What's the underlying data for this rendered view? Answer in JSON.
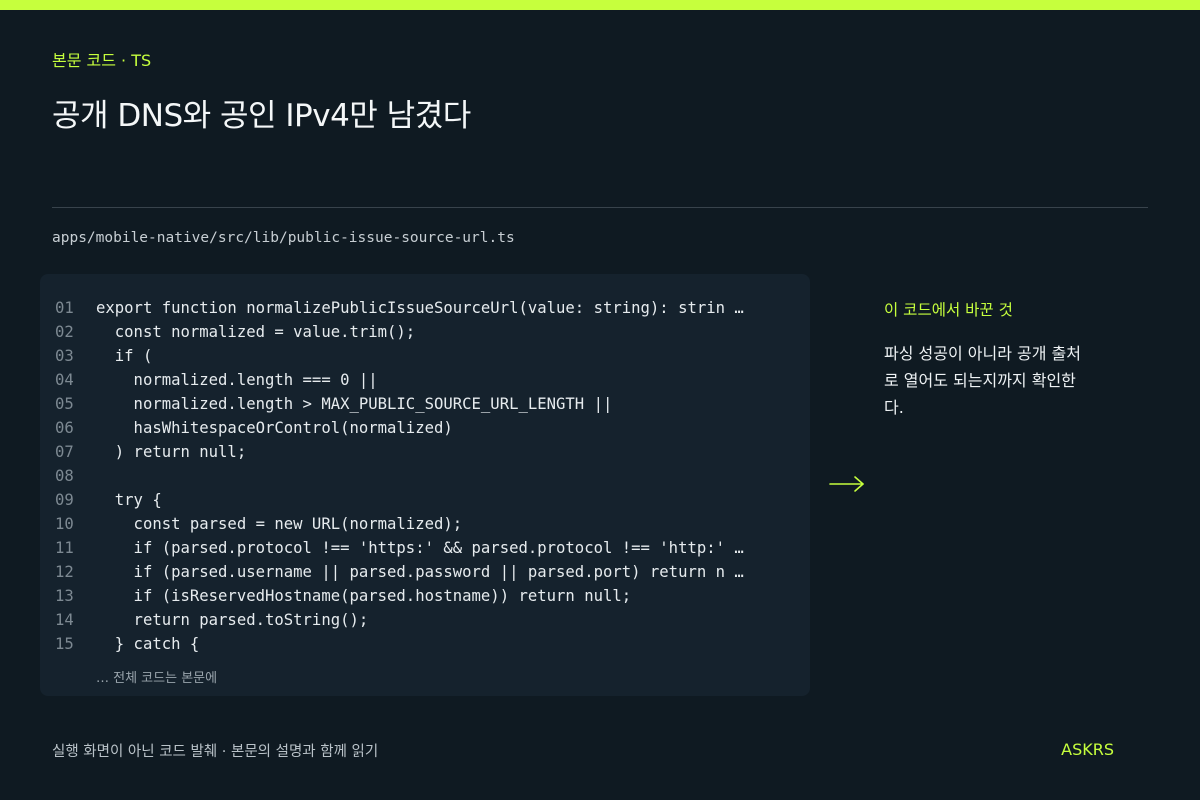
{
  "header": {
    "eyebrow": "본문 코드 · TS",
    "title": "공개 DNS와 공인 IPv4만 남겼다"
  },
  "file": {
    "path": "apps/mobile-native/src/lib/public-issue-source-url.ts"
  },
  "code": {
    "lines": [
      {
        "no": "01",
        "text": "export function normalizePublicIssueSourceUrl(value: string): strin …"
      },
      {
        "no": "02",
        "text": "  const normalized = value.trim();"
      },
      {
        "no": "03",
        "text": "  if ("
      },
      {
        "no": "04",
        "text": "    normalized.length === 0 ||"
      },
      {
        "no": "05",
        "text": "    normalized.length > MAX_PUBLIC_SOURCE_URL_LENGTH ||"
      },
      {
        "no": "06",
        "text": "    hasWhitespaceOrControl(normalized)"
      },
      {
        "no": "07",
        "text": "  ) return null;"
      },
      {
        "no": "08",
        "text": ""
      },
      {
        "no": "09",
        "text": "  try {"
      },
      {
        "no": "10",
        "text": "    const parsed = new URL(normalized);"
      },
      {
        "no": "11",
        "text": "    if (parsed.protocol !== 'https:' && parsed.protocol !== 'http:' …"
      },
      {
        "no": "12",
        "text": "    if (parsed.username || parsed.password || parsed.port) return n …"
      },
      {
        "no": "13",
        "text": "    if (isReservedHostname(parsed.hostname)) return null;"
      },
      {
        "no": "14",
        "text": "    return parsed.toString();"
      },
      {
        "no": "15",
        "text": "  } catch {"
      }
    ],
    "footnote": "… 전체 코드는 본문에"
  },
  "side": {
    "arrow_icon": "right-arrow-icon",
    "heading": "이 코드에서 바꾼 것",
    "body": "파싱 성공이 아니라 공개 출처로 열어도 되는지까지 확인한다."
  },
  "footer": {
    "note": "실행 화면이 아닌 코드 발췌 · 본문의 설명과 함께 읽기",
    "brand": "ASKRS"
  },
  "colors": {
    "background": "#0f1a22",
    "accent": "#c6ff3d",
    "code_panel": "#15222d"
  }
}
